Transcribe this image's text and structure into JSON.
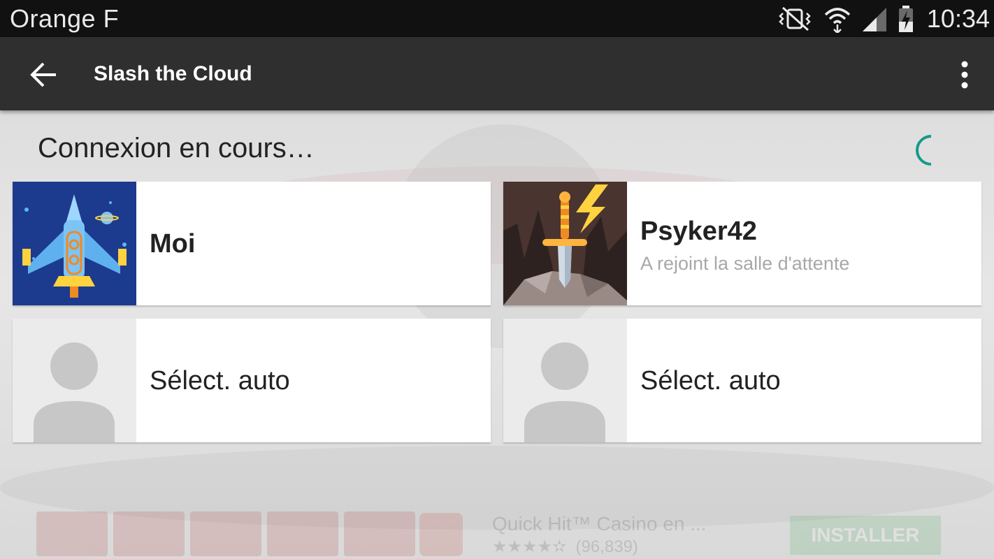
{
  "status_bar": {
    "carrier": "Orange F",
    "time": "10:34",
    "icons": [
      "vibrate-mute-icon",
      "wifi-icon",
      "signal-icon",
      "battery-charging-icon"
    ]
  },
  "app_bar": {
    "title": "Slash the Cloud",
    "back_icon": "arrow-back-icon",
    "menu_icon": "more-vert-icon"
  },
  "main": {
    "status_text": "Connexion en cours…",
    "accent_color": "#16998a",
    "players": [
      {
        "name": "Moi",
        "status": "",
        "avatar": "spaceship-avatar"
      },
      {
        "name": "Psyker42",
        "status": "A rejoint la salle d'attente",
        "avatar": "sword-avatar"
      },
      {
        "name": "Sélect. auto",
        "status": "",
        "avatar": "person-placeholder-icon"
      },
      {
        "name": "Sélect. auto",
        "status": "",
        "avatar": "person-placeholder-icon"
      }
    ]
  },
  "ad_banner": {
    "title": "Quick Hit™ Casino en ...",
    "rating_stars": 4.5,
    "rating_count": "(96,839)",
    "cta": "INSTALLER"
  }
}
